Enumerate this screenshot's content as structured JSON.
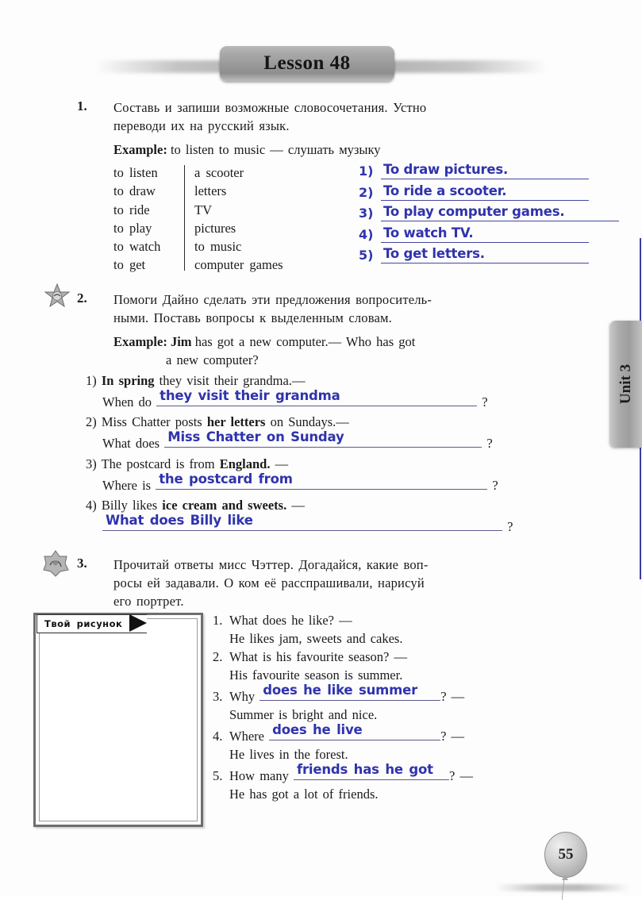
{
  "header": {
    "lesson_title": "Lesson 48"
  },
  "side_tab": {
    "label": "Unit 3"
  },
  "footer": {
    "page_number": "55"
  },
  "colors": {
    "handwriting_blue": "#2f33ad",
    "answer_rule": "#5a5a8f",
    "banner_gray": "#9b9b9b"
  },
  "exercise1": {
    "number": "1.",
    "instruction_line1": "Составь и запиши возможные словосочетания. Устно",
    "instruction_line2": "переводи их на русский язык.",
    "example_label": "Example:",
    "example_text": "to listen to music — слушать музыку",
    "column_a": [
      "to listen",
      "to draw",
      "to ride",
      "to play",
      "to watch",
      "to get"
    ],
    "column_b": [
      "a scooter",
      "letters",
      "TV",
      "pictures",
      "to music",
      "computer games"
    ],
    "answers": [
      {
        "index": "1)",
        "text": "To draw pictures."
      },
      {
        "index": "2)",
        "text": "To ride a scooter."
      },
      {
        "index": "3)",
        "text": "To play computer games."
      },
      {
        "index": "4)",
        "text": "To watch TV."
      },
      {
        "index": "5)",
        "text": "To get letters."
      }
    ]
  },
  "exercise2": {
    "number": "2.",
    "instruction_line1": "Помоги Дайно сделать эти предложения вопроситель-",
    "instruction_line2": "ными. Поставь вопросы к выделенным словам.",
    "example_label": "Example:",
    "example_bold": "Jim",
    "example_line1_rest": "has got a new computer.— Who has got",
    "example_line2": "a new computer?",
    "items": [
      {
        "index": "1)",
        "prompt_bold": "In spring",
        "prompt_rest": "they visit their grandma.—",
        "answer_prefix": "When do",
        "answer_written": "they visit their grandma",
        "answer_suffix": "?"
      },
      {
        "index": "2)",
        "prompt_pre": "Miss Chatter posts",
        "prompt_bold": "her letters",
        "prompt_rest": "on Sundays.—",
        "answer_prefix": "What does",
        "answer_written": "Miss Chatter  on Sunday",
        "answer_suffix": "?"
      },
      {
        "index": "3)",
        "prompt_pre": "The postcard is from",
        "prompt_bold": "England.",
        "prompt_rest": "—",
        "answer_prefix": "Where is",
        "answer_written": "the postcard from",
        "answer_suffix": "?"
      },
      {
        "index": "4)",
        "prompt_pre": "Billy likes",
        "prompt_bold": "ice cream and sweets.",
        "prompt_rest": "—",
        "answer_prefix": "",
        "answer_written": "What does Billy like",
        "answer_suffix": "?"
      }
    ]
  },
  "exercise3": {
    "number": "3.",
    "instruction_line1": "Прочитай ответы мисс Чэттер. Догадайся, какие воп-",
    "instruction_line2": "росы ей задавали. О ком её расспрашивали, нарисуй",
    "instruction_line3": "его портрет.",
    "drawing_box_label": "Твой рисунок",
    "items": [
      {
        "number": "1.",
        "question_text": "What does he like? —",
        "written": "",
        "written_after": "",
        "answer": "He likes jam, sweets and cakes."
      },
      {
        "number": "2.",
        "question_text": "What is his favourite season? —",
        "written": "",
        "written_after": "",
        "answer": "His favourite season is summer."
      },
      {
        "number": "3.",
        "question_text": "Why",
        "written": "does he like summer",
        "written_after": "? —",
        "answer": "Summer is bright and nice."
      },
      {
        "number": "4.",
        "question_text": "Where",
        "written": "does he live",
        "written_after": "? —",
        "answer": "He lives in the forest."
      },
      {
        "number": "5.",
        "question_text": "How many",
        "written": "friends has he got",
        "written_after": "? —",
        "answer": "He has got a lot of friends."
      }
    ]
  }
}
